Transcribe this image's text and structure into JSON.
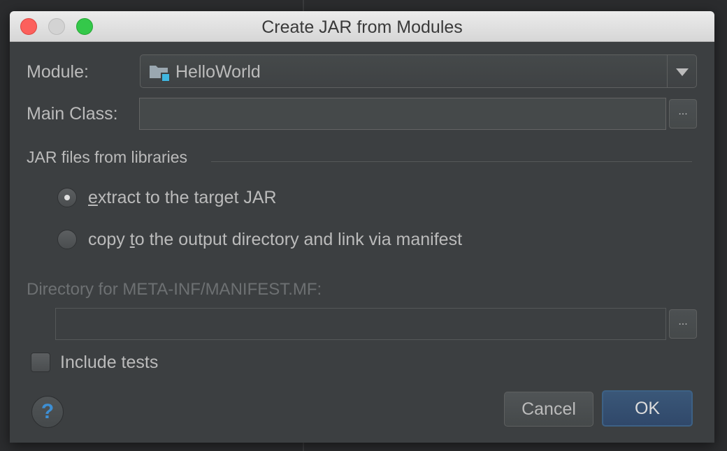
{
  "window": {
    "title": "Create JAR from Modules"
  },
  "module": {
    "label": "Module:",
    "value": "HelloWorld"
  },
  "main_class": {
    "label": "Main Class:",
    "value": "",
    "browse_label": "..."
  },
  "libraries": {
    "section_title": "JAR files from libraries",
    "options": [
      {
        "mnemonic": "e",
        "rest": "xtract to the target JAR",
        "selected": true
      },
      {
        "prefix": "copy ",
        "mnemonic": "t",
        "rest": "o the output directory and link via manifest",
        "selected": false
      }
    ]
  },
  "manifest": {
    "label": "Directory for META-INF/MANIFEST.MF:",
    "value": "",
    "browse_label": "...",
    "enabled": false
  },
  "include_tests": {
    "label": "Include tests",
    "checked": false
  },
  "buttons": {
    "help": "?",
    "cancel": "Cancel",
    "ok": "OK"
  },
  "colors": {
    "dialog_bg": "#3c3f41",
    "text": "#bbbbbb",
    "disabled_text": "#6d7072",
    "ok_button": "#365880",
    "help_icon": "#3d8fd4"
  }
}
